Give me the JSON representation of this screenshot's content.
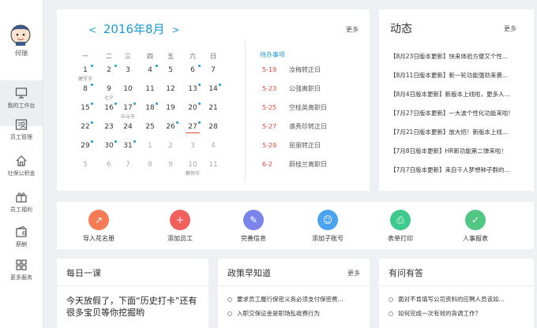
{
  "user": {
    "name": "何瑞"
  },
  "sidebar": {
    "items": [
      {
        "label": "我的工作台",
        "icon": "monitor-icon"
      },
      {
        "label": "员工管理",
        "icon": "employee-card-icon"
      },
      {
        "label": "社保公积金",
        "icon": "house-icon"
      },
      {
        "label": "员工福利",
        "icon": "gift-icon"
      },
      {
        "label": "薪酬",
        "icon": "wallet-icon"
      },
      {
        "label": "更多服务",
        "icon": "grid-icon"
      }
    ]
  },
  "calendar": {
    "title": "2016年8月",
    "prev": "<",
    "next": ">",
    "more": "更多",
    "weekdays": [
      "一",
      "二",
      "三",
      "四",
      "五",
      "六",
      "日"
    ],
    "weeks": [
      [
        {
          "d": "1",
          "sub": "建军节",
          "dot": true
        },
        {
          "d": "2",
          "dot": true
        },
        {
          "d": "3"
        },
        {
          "d": "4",
          "dot": true
        },
        {
          "d": "5"
        },
        {
          "d": "6",
          "dot": true
        },
        {
          "d": "7"
        }
      ],
      [
        {
          "d": "8",
          "dot": true
        },
        {
          "d": "9",
          "sub": "七夕"
        },
        {
          "d": "10"
        },
        {
          "d": "11"
        },
        {
          "d": "12"
        },
        {
          "d": "13",
          "dot": true
        },
        {
          "d": "14",
          "dot": true
        }
      ],
      [
        {
          "d": "15",
          "dot": true
        },
        {
          "d": "16",
          "dot": true
        },
        {
          "d": "17",
          "sub": "中元节",
          "dot": true
        },
        {
          "d": "18",
          "dot": true
        },
        {
          "d": "19"
        },
        {
          "d": "20",
          "dot": true
        },
        {
          "d": "21"
        }
      ],
      [
        {
          "d": "22",
          "dot": true
        },
        {
          "d": "23"
        },
        {
          "d": "24"
        },
        {
          "d": "25"
        },
        {
          "d": "26",
          "dot": true
        },
        {
          "d": "27",
          "dot": true,
          "today": true
        },
        {
          "d": "28"
        }
      ],
      [
        {
          "d": "29",
          "dot": true
        },
        {
          "d": "30",
          "dot": true
        },
        {
          "d": "31",
          "dot": true
        },
        {
          "d": "1",
          "other": true
        },
        {
          "d": "2",
          "other": true
        },
        {
          "d": "3",
          "other": true
        },
        {
          "d": "4",
          "other": true
        }
      ],
      [
        {
          "d": "5",
          "other": true
        },
        {
          "d": "6",
          "other": true
        },
        {
          "d": "7",
          "other": true
        },
        {
          "d": "8",
          "other": true
        },
        {
          "d": "9",
          "other": true
        },
        {
          "d": "10",
          "other": true,
          "sub": "教师节"
        },
        {
          "d": "11",
          "other": true
        }
      ]
    ],
    "todo_title": "待办事项",
    "todos": [
      {
        "date": "5-19",
        "text": "汝梅转正日"
      },
      {
        "date": "5-23",
        "text": "公强离职日"
      },
      {
        "date": "5-25",
        "text": "空桂英离职日"
      },
      {
        "date": "5-27",
        "text": "谯秀珍转正日"
      },
      {
        "date": "5-29",
        "text": "屈丽转正日"
      },
      {
        "date": "6-2",
        "text": "蔚桂兰离职日"
      }
    ]
  },
  "news": {
    "title": "动态",
    "more": "更多",
    "items": [
      "【8月23日版本更新】快来体验方便又个性...",
      "【8月11日版本更新】新一轮功能强劲来袭...",
      "【8月4日版本更新】新版本上线啦，更多人...",
      "【7月27日版本更新】一大波个性化功能来啦!",
      "【7月21日版本更新】放大招！新版本上线...",
      "【7月8日版本更新】HR新功能第二弹来啦！",
      "【7月7日版本更新】来自千人梦想种子群的..."
    ]
  },
  "actions": [
    {
      "label": "导入花名册",
      "color": "#f47b56",
      "icon": "import-icon"
    },
    {
      "label": "添加员工",
      "color": "#f2605d",
      "icon": "add-employee-icon"
    },
    {
      "label": "完善信息",
      "color": "#7b84e8",
      "icon": "edit-info-icon"
    },
    {
      "label": "添加子账号",
      "color": "#4aa3ef",
      "icon": "sub-account-icon"
    },
    {
      "label": "表单打印",
      "color": "#3ec98d",
      "icon": "printer-icon"
    },
    {
      "label": "人事报表",
      "color": "#52c784",
      "icon": "report-icon"
    }
  ],
  "lesson": {
    "title": "每日一课",
    "text": "今天放假了，下面“历史打卡”还有很多宝贝等你挖掘哟"
  },
  "policy": {
    "title": "政策早知道",
    "more": "更多",
    "items": [
      "要求员工履行保密义务必须支付保密费...",
      "入职交保证金是职场乱收费行为"
    ]
  },
  "qa": {
    "title": "有问有答",
    "items": [
      "面对不肯填写公司资料的应聘人员该如...",
      "如何完成一次有效的背调工作？"
    ]
  }
}
